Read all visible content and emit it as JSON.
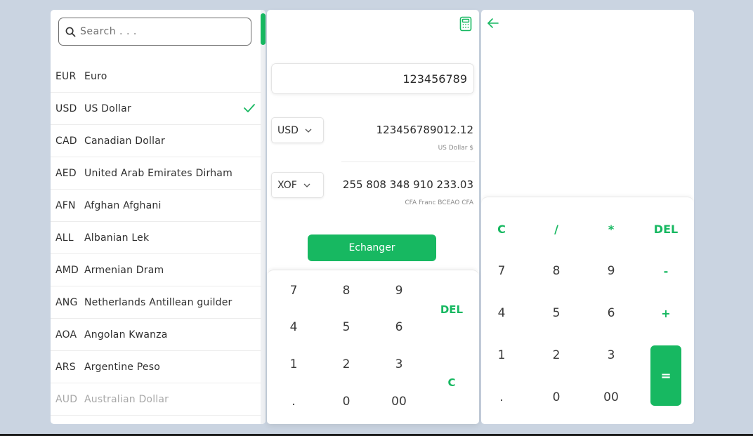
{
  "search": {
    "placeholder": "Search . . ."
  },
  "currencies": [
    {
      "code": "EUR",
      "name": "Euro"
    },
    {
      "code": "USD",
      "name": "US Dollar",
      "selected": true
    },
    {
      "code": "CAD",
      "name": "Canadian Dollar"
    },
    {
      "code": "AED",
      "name": "United Arab Emirates Dirham"
    },
    {
      "code": "AFN",
      "name": "Afghan Afghani"
    },
    {
      "code": "ALL",
      "name": "Albanian Lek"
    },
    {
      "code": "AMD",
      "name": "Armenian Dram"
    },
    {
      "code": "ANG",
      "name": "Netherlands Antillean guilder"
    },
    {
      "code": "AOA",
      "name": "Angolan Kwanza"
    },
    {
      "code": "ARS",
      "name": "Argentine Peso"
    },
    {
      "code": "AUD",
      "name": "Australian Dollar"
    }
  ],
  "converter": {
    "amount": "123456789",
    "from": {
      "code": "USD",
      "value": "123456789012.12",
      "label": "US Dollar $"
    },
    "to": {
      "code": "XOF",
      "value": "255 808 348 910 233.03",
      "label": "CFA Franc BCEAO CFA"
    },
    "exchange_label": "Echanger",
    "keys": {
      "k7": "7",
      "k8": "8",
      "k9": "9",
      "del": "DEL",
      "k4": "4",
      "k5": "5",
      "k6": "6",
      "k1": "1",
      "k2": "2",
      "k3": "3",
      "clear": "C",
      "dot": ".",
      "k0": "0",
      "k00": "00"
    }
  },
  "calculator": {
    "keys": {
      "clear": "C",
      "divide": "/",
      "multiply": "*",
      "del": "DEL",
      "k7": "7",
      "k8": "8",
      "k9": "9",
      "minus": "-",
      "k4": "4",
      "k5": "5",
      "k6": "6",
      "plus": "+",
      "k1": "1",
      "k2": "2",
      "k3": "3",
      "equals": "=",
      "dot": ".",
      "k0": "0",
      "k00": "00"
    }
  },
  "colors": {
    "accent": "#17b861",
    "background": "#cad4e1"
  },
  "icons": {
    "search": "search-icon",
    "check": "check-icon",
    "calculator": "calculator-icon",
    "back": "arrow-left-icon",
    "chevron": "chevron-down-icon"
  }
}
